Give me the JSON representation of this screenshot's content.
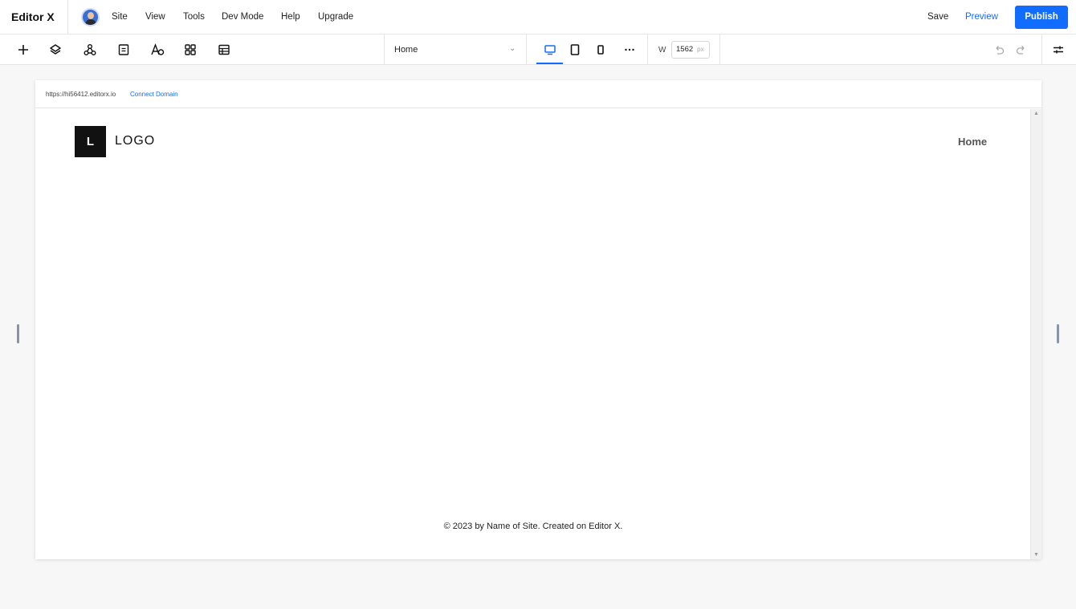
{
  "topbar": {
    "brand": "Editor X",
    "menu": [
      "Site",
      "View",
      "Tools",
      "Dev Mode",
      "Help",
      "Upgrade"
    ],
    "save": "Save",
    "preview": "Preview",
    "publish": "Publish"
  },
  "toolbar": {
    "tools": [
      "add-icon",
      "layers-icon",
      "connect-icon",
      "pages-icon",
      "text-theme-icon",
      "apps-icon",
      "cms-table-icon"
    ],
    "page_select": "Home",
    "devices": [
      "desktop-icon",
      "tablet-icon",
      "mobile-icon",
      "more-icon"
    ],
    "width_label": "W",
    "width_value": "1562",
    "width_unit": "px"
  },
  "site": {
    "url": "https://hi56412.editorx.io",
    "connect_domain": "Connect Domain",
    "logo_letter": "L",
    "logo_text": "LOGO",
    "nav_home": "Home",
    "footer": "© 2023 by Name of Site. Created on Editor X."
  },
  "colors": {
    "accent": "#116dff",
    "canvas_bg": "#f7f7f8"
  }
}
